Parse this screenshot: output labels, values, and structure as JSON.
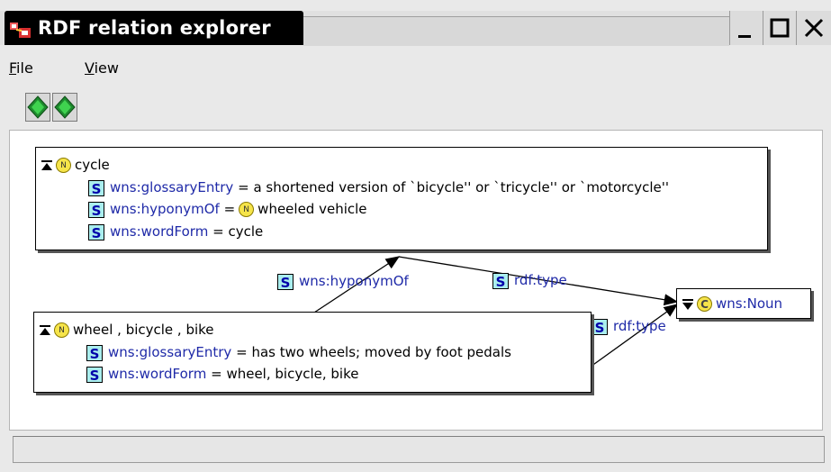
{
  "window": {
    "title": "RDF relation explorer",
    "controls": [
      "minimize",
      "maximize",
      "close"
    ]
  },
  "menu": {
    "file": {
      "accel": "F",
      "rest": "ile"
    },
    "view": {
      "accel": "V",
      "rest": "iew"
    }
  },
  "toolbar": {
    "buttons": [
      {
        "icon": "back-diamond-icon"
      },
      {
        "icon": "forward-diamond-icon"
      }
    ]
  },
  "graph": {
    "nodes": {
      "cycle": {
        "label": "cycle",
        "badge": "N",
        "properties": [
          {
            "tag": "S",
            "predicate": "wns:glossaryEntry",
            "sep": "=",
            "value": "a shortened version of `bicycle'' or `tricycle'' or `motorcycle''"
          },
          {
            "tag": "S",
            "predicate": "wns:hyponymOf",
            "sep": "=",
            "value_badge": "N",
            "value": "wheeled vehicle"
          },
          {
            "tag": "S",
            "predicate": "wns:wordForm",
            "sep": "=",
            "value": "cycle"
          }
        ]
      },
      "wheel": {
        "label": "wheel , bicycle , bike",
        "badge": "N",
        "properties": [
          {
            "tag": "S",
            "predicate": "wns:glossaryEntry",
            "sep": "=",
            "value": "has two wheels; moved by foot pedals"
          },
          {
            "tag": "S",
            "predicate": "wns:wordForm",
            "sep": "=",
            "value": "wheel, bicycle, bike"
          }
        ]
      },
      "noun": {
        "label": "wns:Noun",
        "badge": "C"
      }
    },
    "edges": [
      {
        "tag": "S",
        "label": "wns:hyponymOf"
      },
      {
        "tag": "S",
        "label": "rdf:type"
      },
      {
        "tag": "S",
        "label": "rdf:type"
      }
    ]
  },
  "status": {
    "text": ""
  },
  "colors": {
    "predicate": "#1f2aa8",
    "s_tag_bg": "#aaeeee",
    "badge_bg": "#f6e44a",
    "title_bg": "#000000"
  }
}
